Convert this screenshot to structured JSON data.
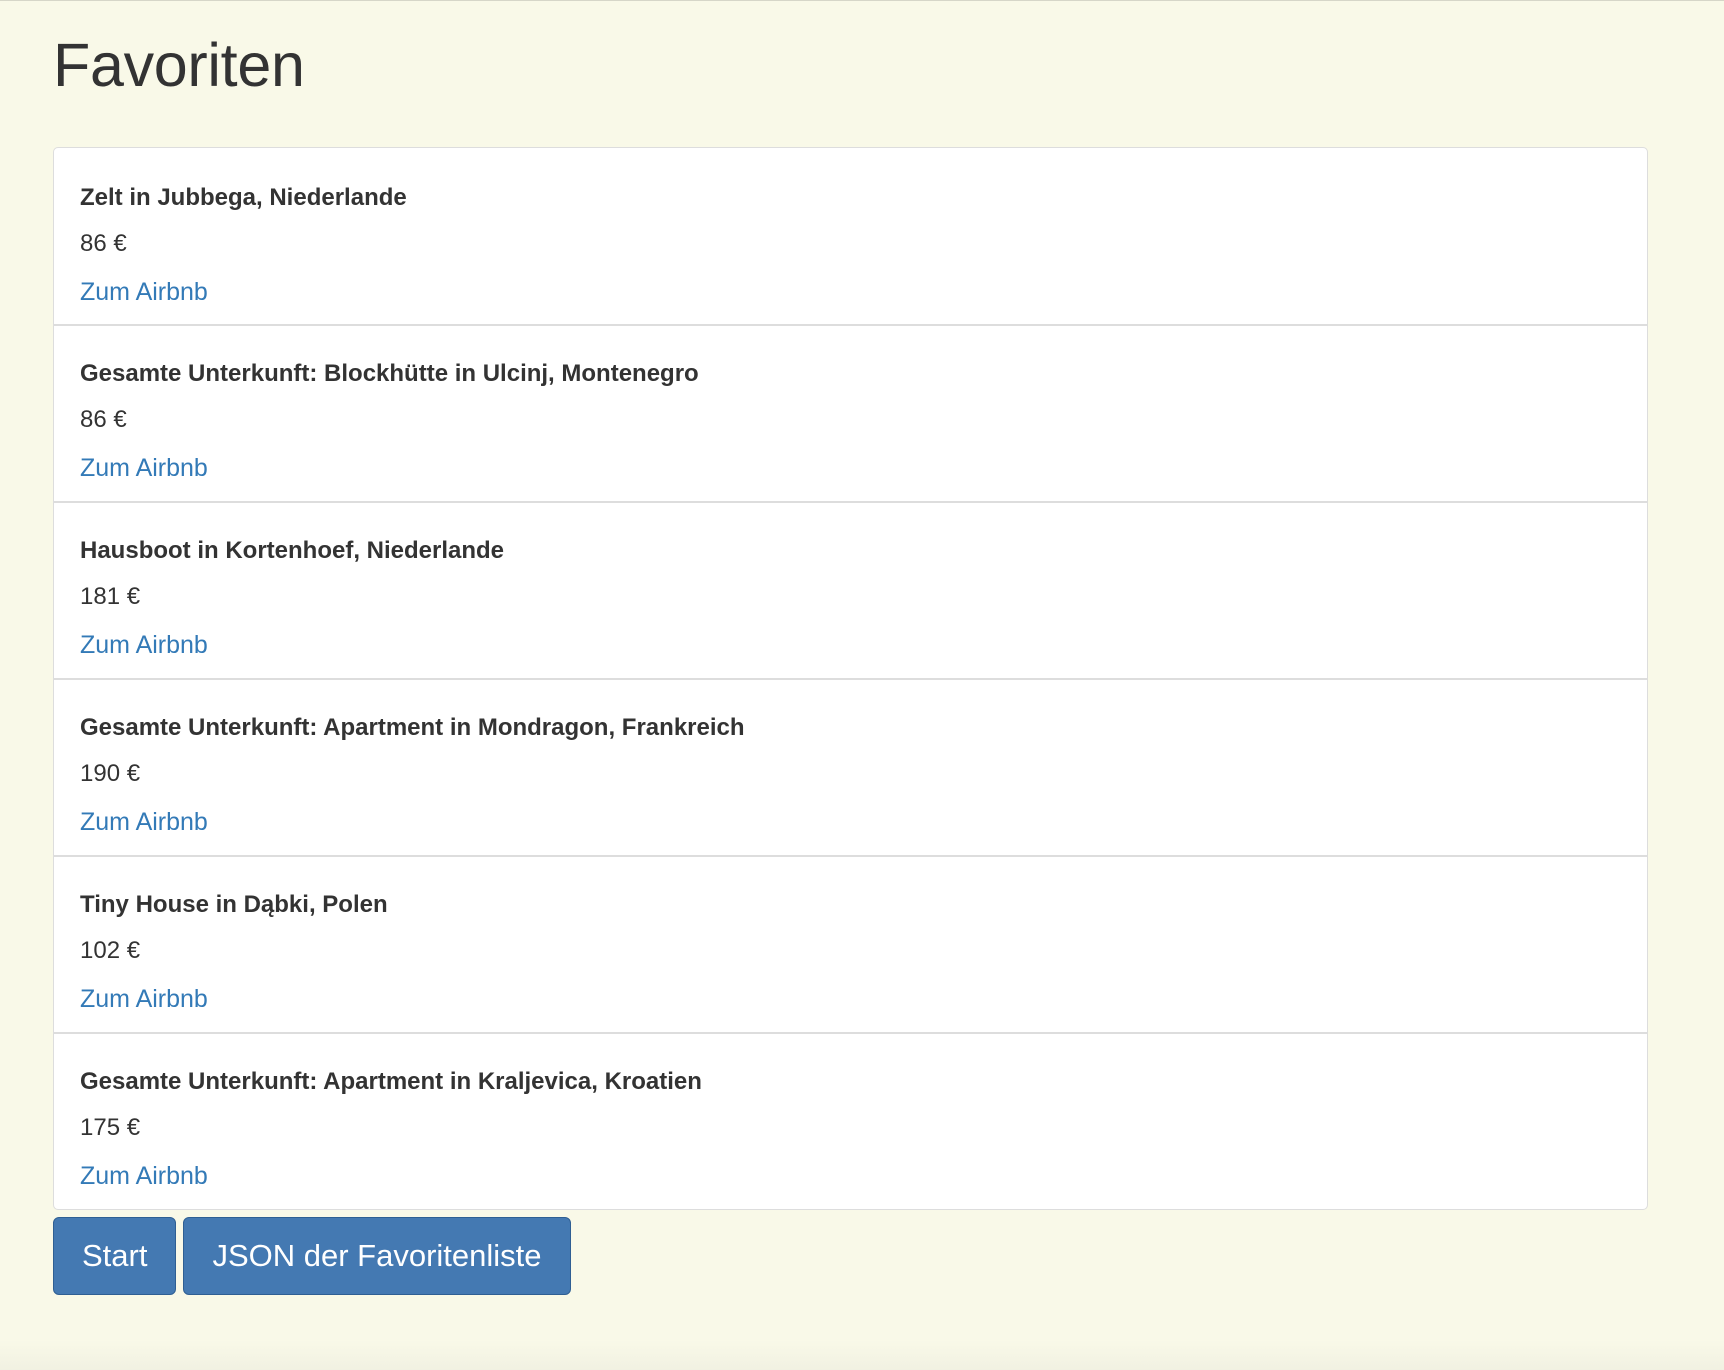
{
  "page": {
    "title": "Favoriten"
  },
  "favorites": [
    {
      "title": "Zelt in Jubbega, Niederlande",
      "price": "86 €",
      "link_label": "Zum Airbnb"
    },
    {
      "title": "Gesamte Unterkunft: Blockhütte in Ulcinj, Montenegro",
      "price": "86 €",
      "link_label": "Zum Airbnb"
    },
    {
      "title": "Hausboot in Kortenhoef, Niederlande",
      "price": "181 €",
      "link_label": "Zum Airbnb"
    },
    {
      "title": "Gesamte Unterkunft: Apartment in Mondragon, Frankreich",
      "price": "190 €",
      "link_label": "Zum Airbnb"
    },
    {
      "title": "Tiny House in Dąbki, Polen",
      "price": "102 €",
      "link_label": "Zum Airbnb"
    },
    {
      "title": "Gesamte Unterkunft: Apartment in Kraljevica, Kroatien",
      "price": "175 €",
      "link_label": "Zum Airbnb"
    }
  ],
  "actions": {
    "start_label": "Start",
    "json_label": "JSON der Favoritenliste"
  },
  "colors": {
    "background": "#f9f9e8",
    "link": "#337ab7",
    "button": "#4479b2",
    "text": "#333333"
  }
}
